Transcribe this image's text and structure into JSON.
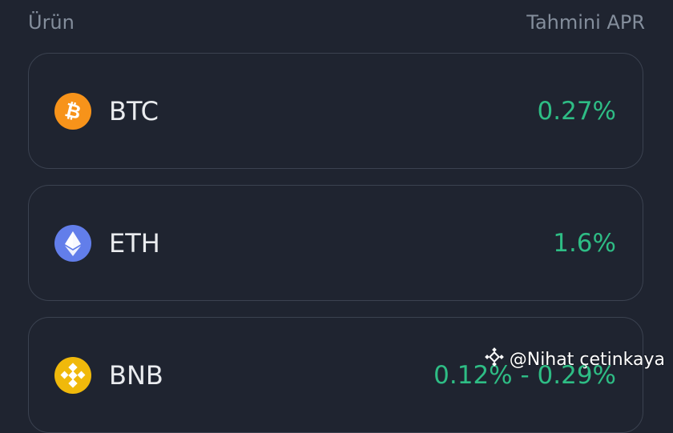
{
  "header": {
    "product_label": "Ürün",
    "apr_label": "Tahmini APR"
  },
  "products": [
    {
      "name": "BTC",
      "apr": "0.27%",
      "icon": "bitcoin-icon",
      "icon_color": "#f7931a"
    },
    {
      "name": "ETH",
      "apr": "1.6%",
      "icon": "ethereum-icon",
      "icon_color": "#627eea"
    },
    {
      "name": "BNB",
      "apr": "0.12% - 0.29%",
      "icon": "bnb-icon",
      "icon_color": "#f0b90b"
    }
  ],
  "colors": {
    "background": "#1f2430",
    "apr_green": "#2ebd85",
    "muted": "#848e9c"
  },
  "watermark": {
    "text": "@Nihat çetinkaya",
    "icon": "binance-logo-icon"
  }
}
